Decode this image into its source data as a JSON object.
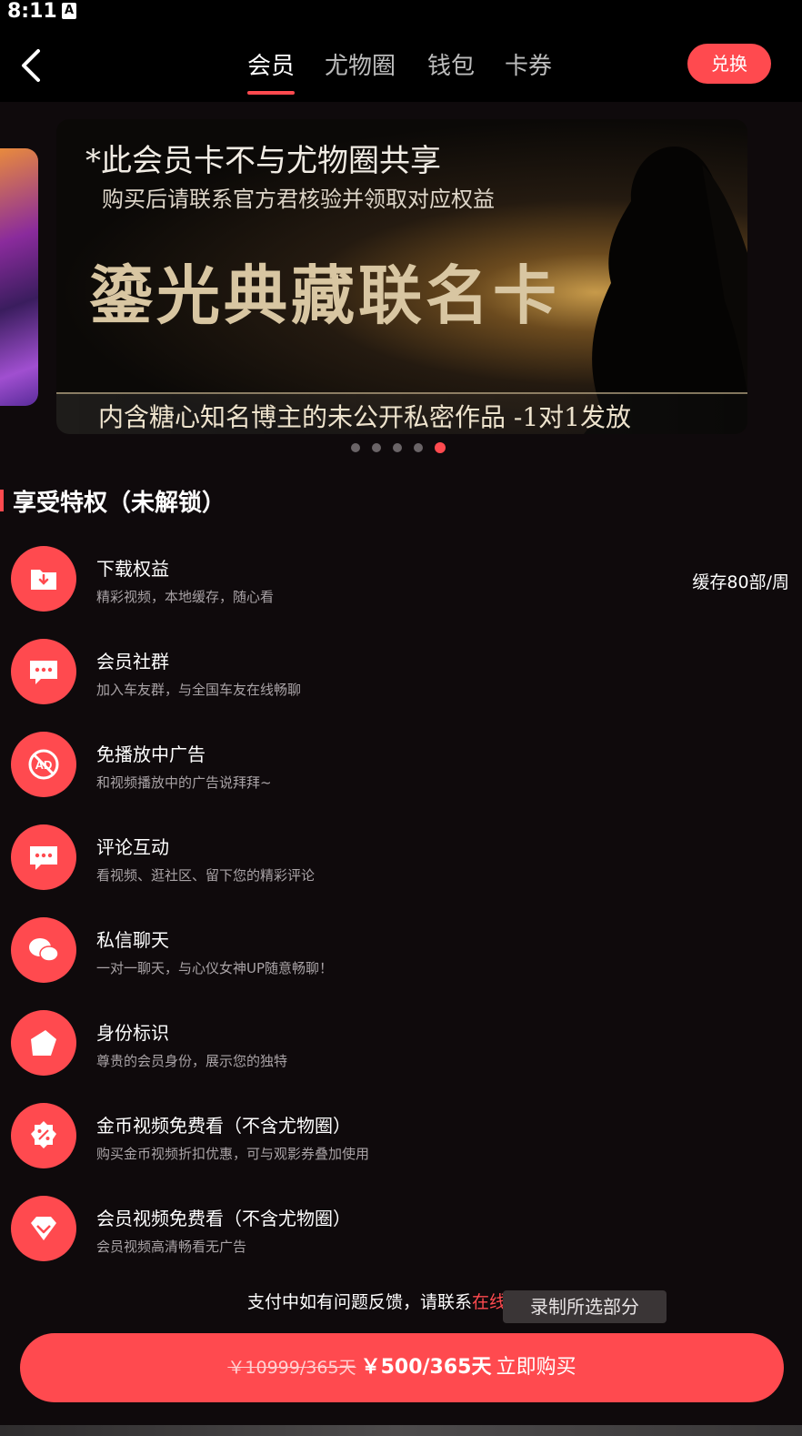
{
  "status_bar": {
    "time": "8:11",
    "notification_icon": "A"
  },
  "header": {
    "back_icon": "chevron-left-icon",
    "tabs": [
      {
        "label": "会员",
        "active": true
      },
      {
        "label": "尤物圈",
        "active": false
      },
      {
        "label": "钱包",
        "active": false
      },
      {
        "label": "卡券",
        "active": false
      }
    ],
    "redeem_label": "兑换"
  },
  "banner": {
    "line1": "*此会员卡不与尤物圈共享",
    "line2": "购买后请联系官方君核验并领取对应权益",
    "title": "鎏光典藏联名卡",
    "line3": "内含糖心知名博主的未公开私密作品 -1对1发放",
    "total_slides": 5,
    "active_slide": 5
  },
  "section": {
    "title": "享受特权（未解锁）"
  },
  "perks": [
    {
      "icon": "download-folder-icon",
      "title": "下载权益",
      "desc": "精彩视频，本地缓存，随心看",
      "extra": "缓存80部/周"
    },
    {
      "icon": "chat-bubble-icon",
      "title": "会员社群",
      "desc": "加入车友群，与全国车友在线畅聊",
      "extra": ""
    },
    {
      "icon": "no-ad-icon",
      "title": "免播放中广告",
      "desc": "和视频播放中的广告说拜拜~",
      "extra": ""
    },
    {
      "icon": "comment-icon",
      "title": "评论互动",
      "desc": "看视频、逛社区、留下您的精彩评论",
      "extra": ""
    },
    {
      "icon": "private-message-icon",
      "title": "私信聊天",
      "desc": "一对一聊天，与心仪女神UP随意畅聊！",
      "extra": ""
    },
    {
      "icon": "identity-badge-icon",
      "title": "身份标识",
      "desc": "尊贵的会员身份，展示您的独特",
      "extra": ""
    },
    {
      "icon": "discount-coin-icon",
      "title": "金币视频免费看（不含尤物圈）",
      "desc": "购买金币视频折扣优惠，可与观影券叠加使用",
      "extra": ""
    },
    {
      "icon": "diamond-icon",
      "title": "会员视频免费看（不含尤物圈）",
      "desc": "会员视频高清畅看无广告",
      "extra": ""
    }
  ],
  "footer": {
    "help_text": "支付中如有问题反馈，请联系",
    "help_link": "在线",
    "toast": "录制所选部分",
    "old_price": "￥10999/365天",
    "new_price": "￥500/365天",
    "buy_label": "立即购买"
  },
  "colors": {
    "accent": "#ff4a4f",
    "background": "#0f0a0c"
  }
}
